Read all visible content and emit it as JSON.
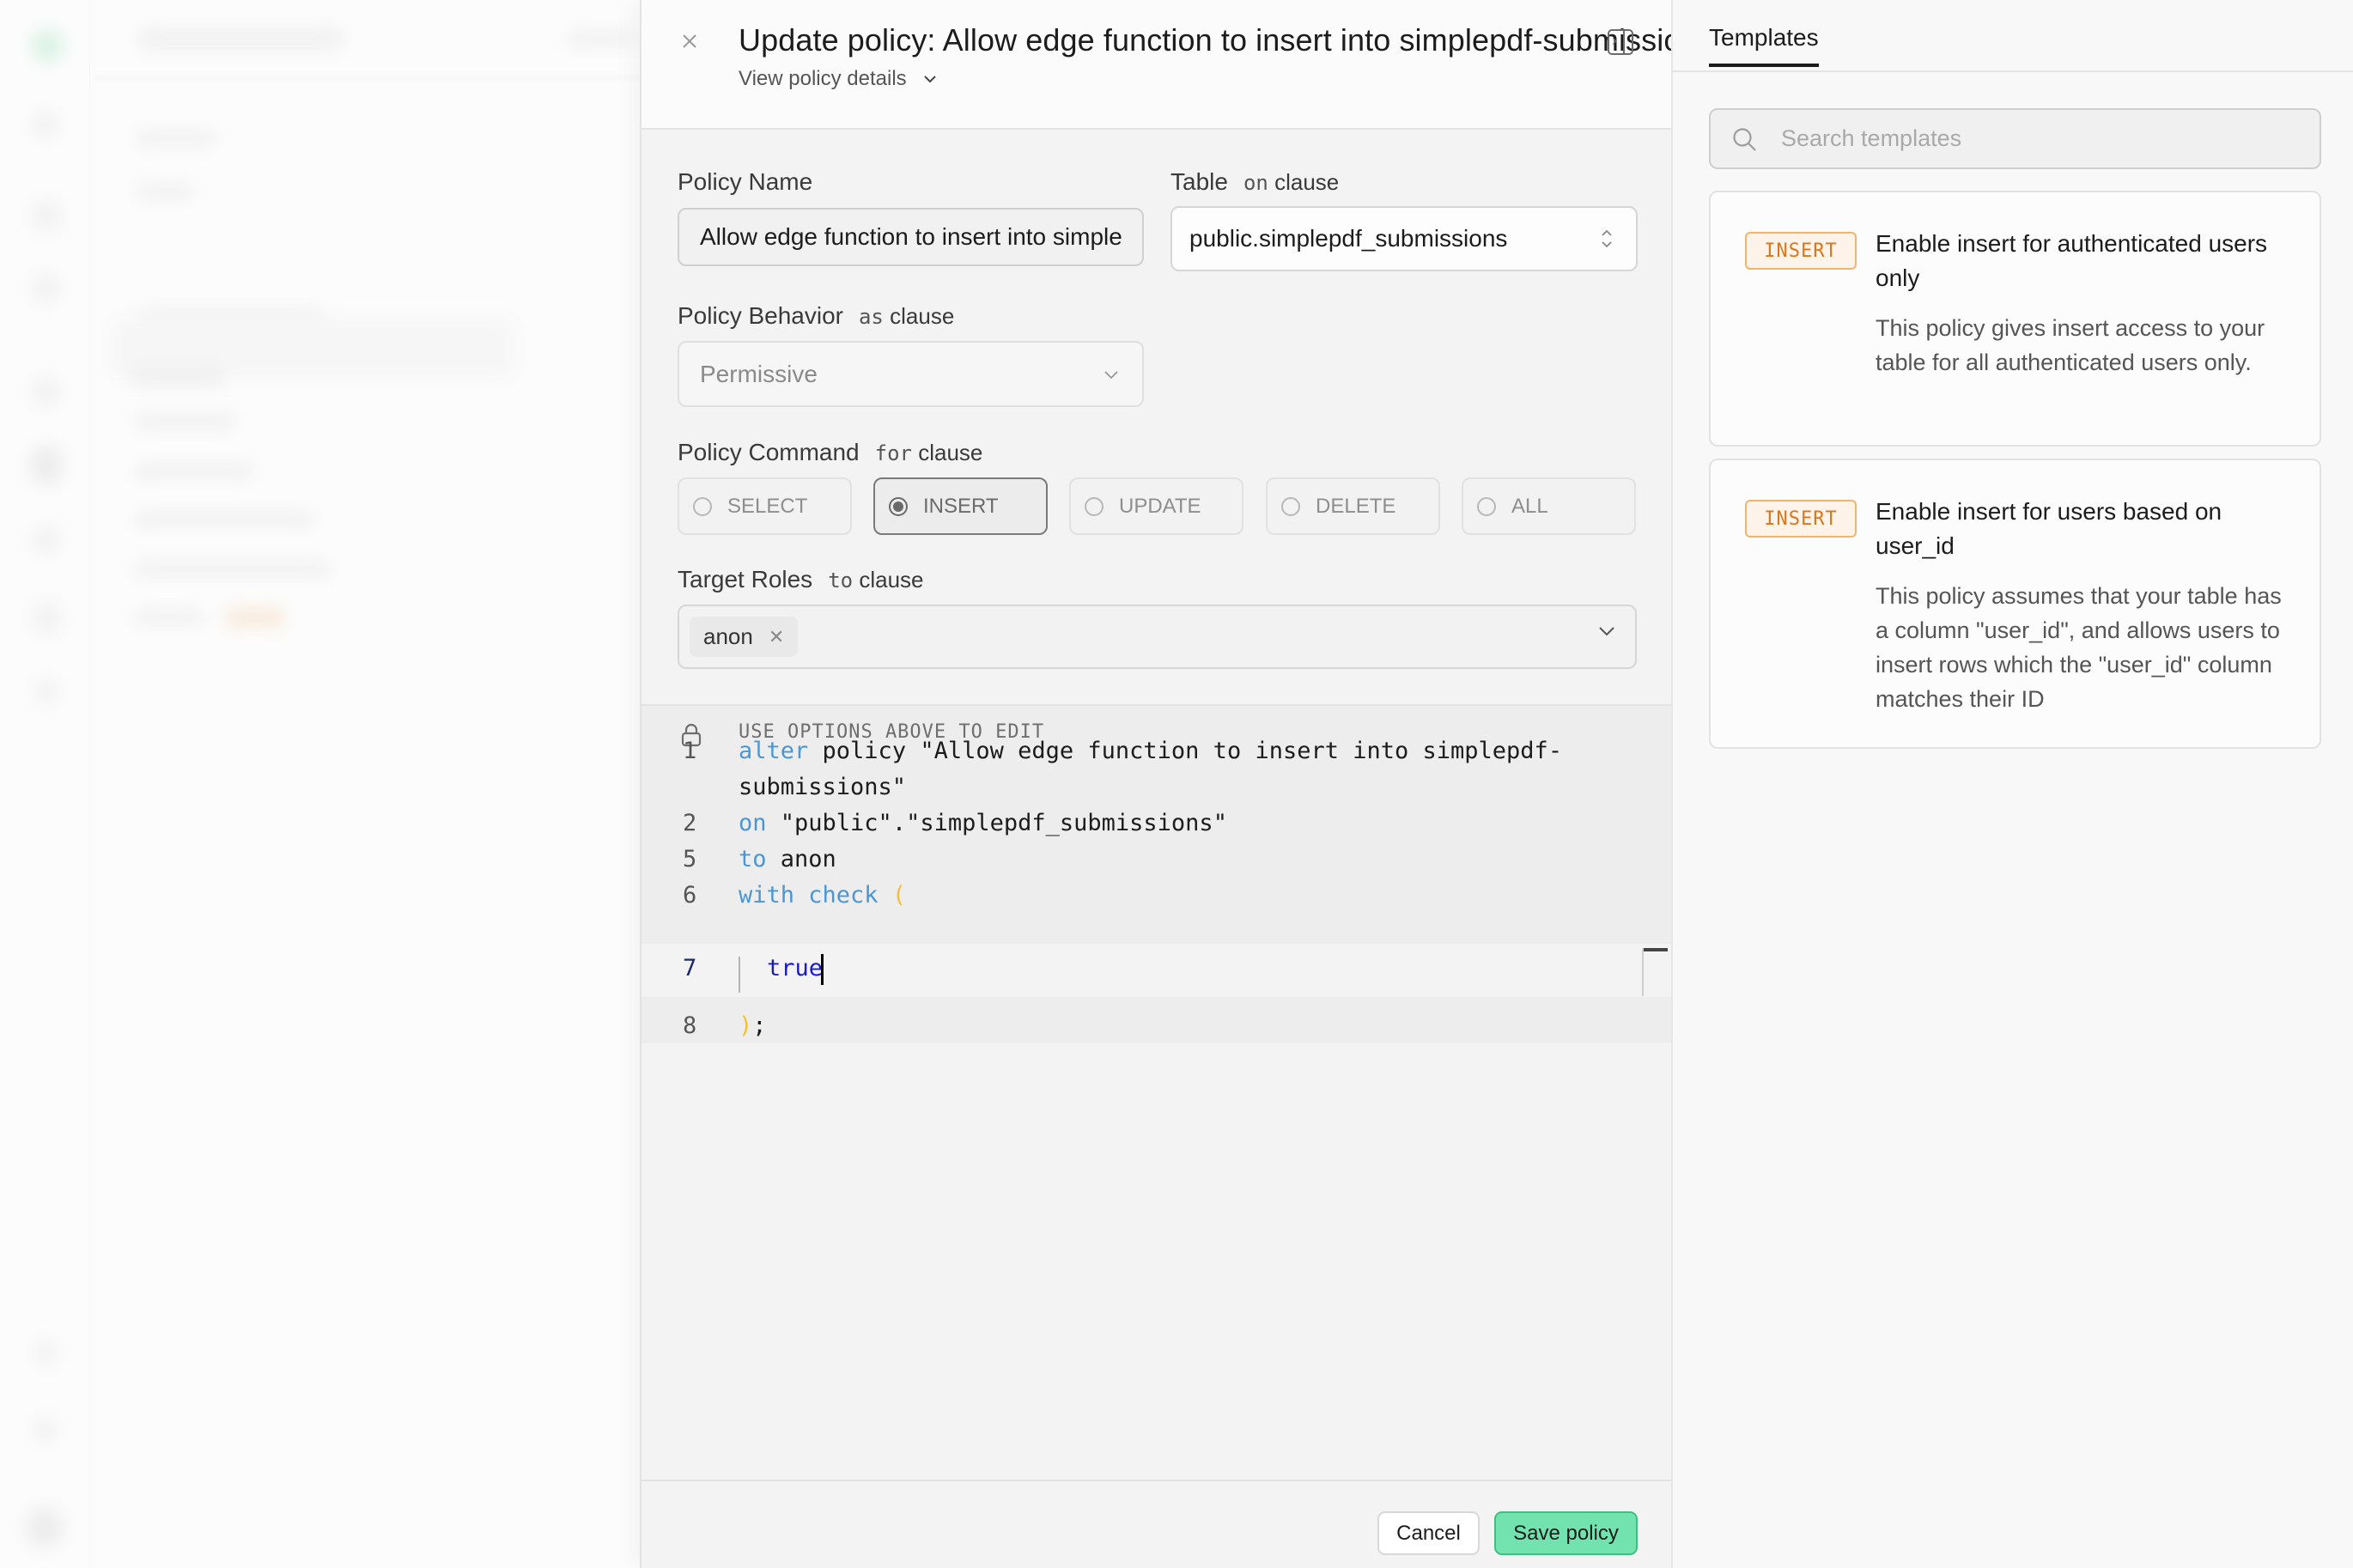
{
  "modal": {
    "title": "Update policy: Allow edge function to insert into simplepdf-submissions",
    "view_details_label": "View policy details",
    "form": {
      "policy_name": {
        "label": "Policy Name",
        "value": "Allow edge function to insert into simplepdf-submissions"
      },
      "table": {
        "label": "Table",
        "clause_keyword": "on",
        "clause_word": "clause",
        "value": "public.simplepdf_submissions"
      },
      "behavior": {
        "label": "Policy Behavior",
        "clause_keyword": "as",
        "clause_word": "clause",
        "value": "Permissive"
      },
      "command": {
        "label": "Policy Command",
        "clause_keyword": "for",
        "clause_word": "clause",
        "options": [
          {
            "label": "SELECT",
            "selected": false
          },
          {
            "label": "INSERT",
            "selected": true
          },
          {
            "label": "UPDATE",
            "selected": false
          },
          {
            "label": "DELETE",
            "selected": false
          },
          {
            "label": "ALL",
            "selected": false
          }
        ]
      },
      "roles": {
        "label": "Target Roles",
        "clause_keyword": "to",
        "clause_word": "clause",
        "selected": [
          "anon"
        ]
      }
    },
    "editor": {
      "hint": "USE OPTIONS ABOVE TO EDIT",
      "lines": [
        {
          "num": "1",
          "tokens": [
            {
              "t": "alter",
              "c": "kw"
            },
            {
              "t": " policy \"Allow edge function to insert into simplepdf-",
              "c": ""
            }
          ]
        },
        {
          "num": "",
          "tokens": [
            {
              "t": "submissions\"",
              "c": ""
            }
          ]
        },
        {
          "num": "2",
          "tokens": [
            {
              "t": "on",
              "c": "kw"
            },
            {
              "t": " \"public\".\"simplepdf_submissions\"",
              "c": ""
            }
          ]
        },
        {
          "num": "5",
          "tokens": [
            {
              "t": "to",
              "c": "kw"
            },
            {
              "t": " anon",
              "c": ""
            }
          ]
        },
        {
          "num": "6",
          "tokens": [
            {
              "t": "with check",
              "c": "kw"
            },
            {
              "t": " ",
              "c": ""
            },
            {
              "t": "(",
              "c": "paren"
            }
          ]
        },
        {
          "num": "7",
          "tokens": [
            {
              "t": "true",
              "c": "lit"
            }
          ]
        },
        {
          "num": "8",
          "tokens": [
            {
              "t": ")",
              "c": "paren"
            },
            {
              "t": ";",
              "c": ""
            }
          ]
        }
      ]
    },
    "footer": {
      "cancel_label": "Cancel",
      "save_label": "Save policy"
    }
  },
  "templates": {
    "tab_label": "Templates",
    "search_placeholder": "Search templates",
    "items": [
      {
        "badge": "INSERT",
        "title": "Enable insert for authenticated users only",
        "description": "This policy gives insert access to your table for all authenticated users only."
      },
      {
        "badge": "INSERT",
        "title": "Enable insert for users based on user_id",
        "description": "This policy assumes that your table has a column \"user_id\", and allows users to insert rows which the \"user_id\" column matches their ID"
      }
    ]
  },
  "colors": {
    "save_button": "#72e3ae",
    "badge_insert": "#d9771f",
    "keyword": "#4b97d5",
    "paren": "#f2c230"
  }
}
